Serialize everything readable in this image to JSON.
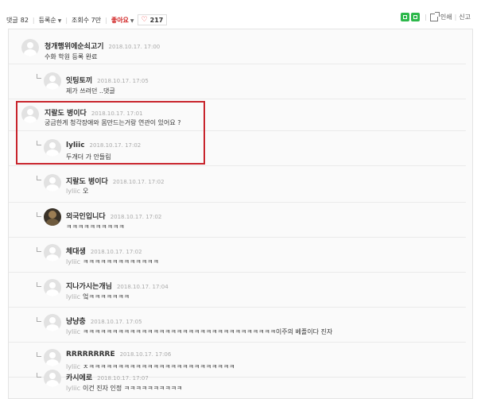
{
  "toolbar": {
    "comment_label": "댓글",
    "comment_count": "82",
    "sort_label": "등록순",
    "views_label": "조회수 7만",
    "like_label": "좋아요",
    "like_count": "217",
    "print_label": "인쇄",
    "report_label": "신고"
  },
  "comments": [
    {
      "name": "청개행위에순쇠고기",
      "date": "2018.10.17. 17:00",
      "text": "수화 학원 등록 완료",
      "mention": "",
      "reply": false
    },
    {
      "name": "잇팅토끼",
      "date": "2018.10.17. 17:05",
      "text": "제가 쓰려던 ..댓글",
      "mention": "",
      "reply": true
    },
    {
      "name": "지랄도 병이다",
      "date": "2018.10.17. 17:01",
      "text": "궁금한게 청각장애와 몸만드는거랑 연관이 있어요 ?",
      "mention": "",
      "reply": false
    },
    {
      "name": "lyliic",
      "date": "2018.10.17. 17:02",
      "text": "두개더 가 안들림",
      "mention": "",
      "reply": true
    },
    {
      "name": "지랄도 병이다",
      "date": "2018.10.17. 17:02",
      "text": "오",
      "mention": "lyliic",
      "reply": true
    },
    {
      "name": "외국인입니다",
      "date": "2018.10.17. 17:02",
      "text": "ㅋㅋㅋㅋㅋㅋㅋㅋㅋㅋ",
      "mention": "",
      "reply": true
    },
    {
      "name": "체대생",
      "date": "2018.10.17. 17:02",
      "text": "ㅋㅋㅋㅋㅋㅋㅋㅋㅋㅋㅋㅋㅋ",
      "mention": "lyliic",
      "reply": true
    },
    {
      "name": "지나가시는개님",
      "date": "2018.10.17. 17:04",
      "text": "엌ㅋㅋㅋㅋㅋㅋㅋ",
      "mention": "lyliic",
      "reply": true
    },
    {
      "name": "냥냥충",
      "date": "2018.10.17. 17:05",
      "text": "ㅋㅋㅋㅋㅋㅋㅋㅋㅋㅋㅋㅋㅋㅋㅋㅋㅋㅋㅋㅋㅋㅋㅋㅋㅋㅋㅋㅋㅋㅋㅋㅋㅋ이주의 베플이다 진자",
      "mention": "lyliic",
      "reply": true
    },
    {
      "name": "RRRRRRRRE",
      "date": "2018.10.17. 17:06",
      "text": "ㅈㅋㅋㅋㅋㅋㅋㅋㅋㅋㅋㅋㅋㅋㅋㅋㅋㅋㅋㅋㅋㅋㅋㅋㅋㅋ",
      "mention": "lyliic",
      "reply": true
    },
    {
      "name": "카시에로",
      "date": "2018.10.17. 17:07",
      "text": "이건 진자 인정 ㅋㅋㅋㅋㅋㅋㅋㅋㅋㅋ",
      "mention": "lyliic",
      "reply": true
    }
  ],
  "colors": {
    "accent_like": "#d02020",
    "highlight_box": "#c8252d",
    "bookmark_green": "#2db84b"
  }
}
